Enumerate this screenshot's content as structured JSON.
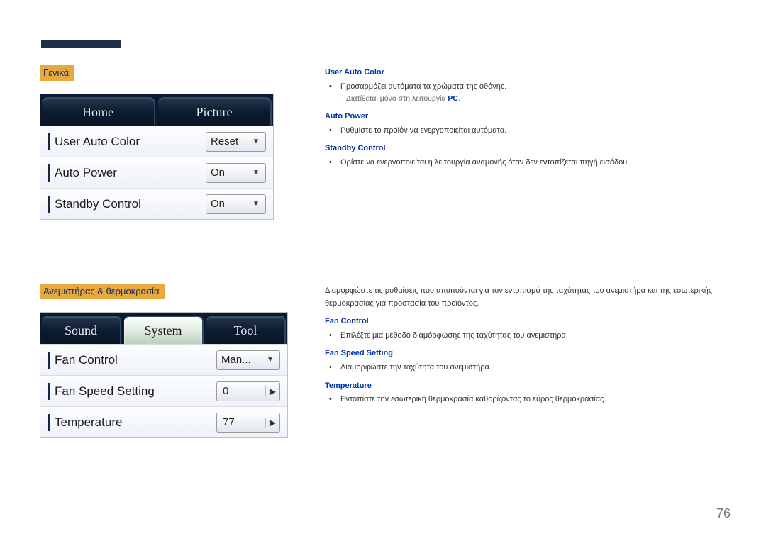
{
  "page_number": "76",
  "general": {
    "label": "Γενικά",
    "tabs": {
      "home": "Home",
      "picture": "Picture"
    },
    "rows": {
      "user_auto_color": {
        "label": "User Auto Color",
        "value": "Reset"
      },
      "auto_power": {
        "label": "Auto Power",
        "value": "On"
      },
      "standby_control": {
        "label": "Standby Control",
        "value": "On"
      }
    },
    "desc": {
      "user_auto_color": {
        "title": "User Auto Color",
        "bullet": "Προσαρμόζει αυτόματα τα χρώματα της οθόνης.",
        "sub_prefix": "Διατίθεται μόνο στη λειτουργία ",
        "sub_pc": "PC",
        "sub_suffix": "."
      },
      "auto_power": {
        "title": "Auto Power",
        "bullet": "Ρυθμίστε το προϊόν να ενεργοποιείται αυτόματα."
      },
      "standby_control": {
        "title": "Standby Control",
        "bullet": "Ορίστε να ενεργοποιείται η λειτουργία αναμονής όταν δεν εντοπίζεται πηγή εισόδου."
      }
    }
  },
  "fan": {
    "label": "Ανεμιστήρας & θερμοκρασία",
    "intro": "Διαμορφώστε τις ρυθμίσεις που απαιτούνται για τον εντοπισμό της ταχύτητας του ανεμιστήρα και της εσωτερικής θερμοκρασίας για προστασία του προϊόντος.",
    "tabs": {
      "sound": "Sound",
      "system": "System",
      "tool": "Tool"
    },
    "rows": {
      "fan_control": {
        "label": "Fan Control",
        "value": "Man..."
      },
      "fan_speed_setting": {
        "label": "Fan Speed Setting",
        "value": "0"
      },
      "temperature": {
        "label": "Temperature",
        "value": "77"
      }
    },
    "desc": {
      "fan_control": {
        "title": "Fan Control",
        "bullet": "Επιλέξτε μια μέθοδο διαμόρφωσης της ταχύτητας του ανεμιστήρα."
      },
      "fan_speed_setting": {
        "title": "Fan Speed Setting",
        "bullet": "Διαμορφώστε την ταχύτητα του ανεμιστήρα."
      },
      "temperature": {
        "title": "Temperature",
        "bullet": "Εντοπίστε την εσωτερική θερμοκρασία καθορίζοντας το εύρος θερμοκρασίας."
      }
    }
  }
}
